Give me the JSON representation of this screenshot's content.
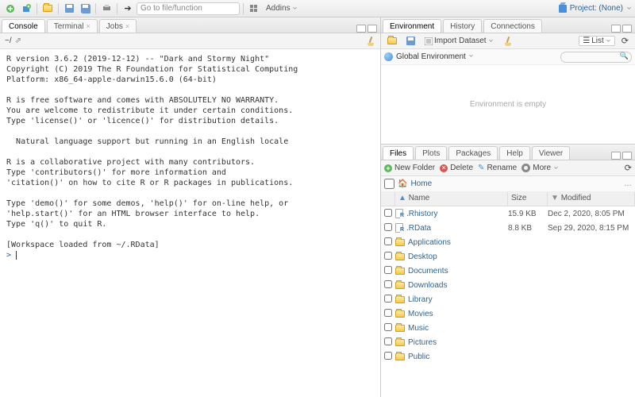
{
  "toolbar": {
    "goto_placeholder": "Go to file/function",
    "addins_label": "Addins",
    "project_label": "Project: (None)"
  },
  "left_tabs": {
    "items": [
      "Console",
      "Terminal",
      "Jobs"
    ],
    "active": 0,
    "path": "~/"
  },
  "console_text": "R version 3.6.2 (2019-12-12) -- \"Dark and Stormy Night\"\nCopyright (C) 2019 The R Foundation for Statistical Computing\nPlatform: x86_64-apple-darwin15.6.0 (64-bit)\n\nR is free software and comes with ABSOLUTELY NO WARRANTY.\nYou are welcome to redistribute it under certain conditions.\nType 'license()' or 'licence()' for distribution details.\n\n  Natural language support but running in an English locale\n\nR is a collaborative project with many contributors.\nType 'contributors()' for more information and\n'citation()' on how to cite R or R packages in publications.\n\nType 'demo()' for some demos, 'help()' for on-line help, or\n'help.start()' for an HTML browser interface to help.\nType 'q()' to quit R.\n\n[Workspace loaded from ~/.RData]\n",
  "console_prompt": "> ",
  "env_tabs": {
    "items": [
      "Environment",
      "History",
      "Connections"
    ],
    "active": 0
  },
  "env_toolbar": {
    "import": "Import Dataset",
    "list": "List"
  },
  "env_sub": {
    "scope": "Global Environment"
  },
  "env_empty": "Environment is empty",
  "files_tabs": {
    "items": [
      "Files",
      "Plots",
      "Packages",
      "Help",
      "Viewer"
    ],
    "active": 0
  },
  "files_toolbar": {
    "new_folder": "New Folder",
    "delete": "Delete",
    "rename": "Rename",
    "more": "More"
  },
  "files_nav": {
    "home": "Home"
  },
  "files_header": {
    "name": "Name",
    "size": "Size",
    "modified": "Modified"
  },
  "files": [
    {
      "name": ".Rhistory",
      "type": "file-r",
      "size": "15.9 KB",
      "modified": "Dec 2, 2020, 8:05 PM"
    },
    {
      "name": ".RData",
      "type": "file-r",
      "size": "8.8 KB",
      "modified": "Sep 29, 2020, 8:15 PM"
    },
    {
      "name": "Applications",
      "type": "folder",
      "size": "",
      "modified": ""
    },
    {
      "name": "Desktop",
      "type": "folder",
      "size": "",
      "modified": ""
    },
    {
      "name": "Documents",
      "type": "folder",
      "size": "",
      "modified": ""
    },
    {
      "name": "Downloads",
      "type": "folder",
      "size": "",
      "modified": ""
    },
    {
      "name": "Library",
      "type": "folder",
      "size": "",
      "modified": ""
    },
    {
      "name": "Movies",
      "type": "folder",
      "size": "",
      "modified": ""
    },
    {
      "name": "Music",
      "type": "folder",
      "size": "",
      "modified": ""
    },
    {
      "name": "Pictures",
      "type": "folder",
      "size": "",
      "modified": ""
    },
    {
      "name": "Public",
      "type": "folder",
      "size": "",
      "modified": ""
    }
  ]
}
